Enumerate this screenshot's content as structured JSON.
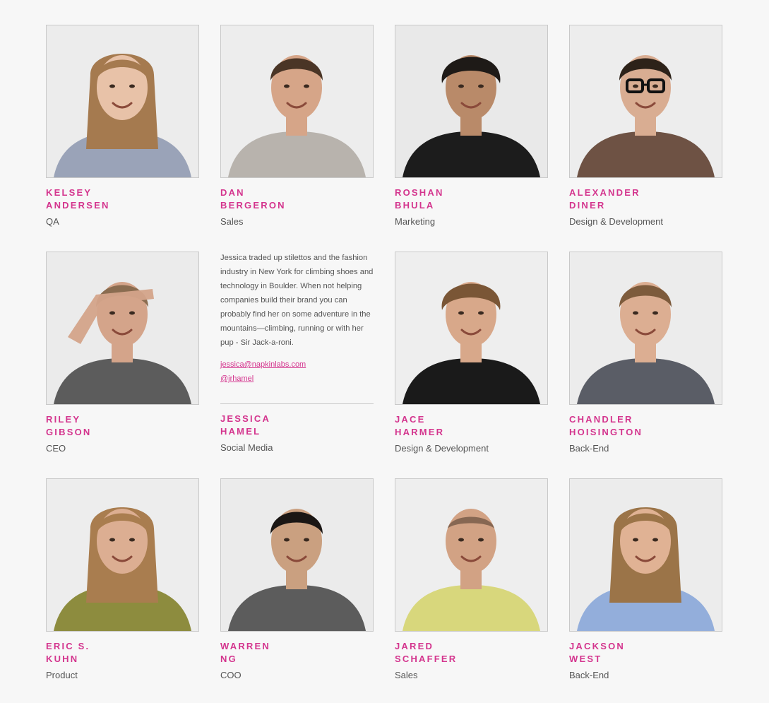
{
  "team": [
    {
      "first": "KELSEY",
      "last": "ANDERSEN",
      "role": "QA",
      "photo": {
        "bg": "#ececec",
        "skin": "#e8c2a8",
        "hair": "#a57a4f",
        "shirt": "#9aa3b8",
        "style": "long"
      }
    },
    {
      "first": "DAN",
      "last": "BERGERON",
      "role": "Sales",
      "photo": {
        "bg": "#ededed",
        "skin": "#d6a588",
        "hair": "#4a3526",
        "shirt": "#b8b3ad",
        "style": "short"
      }
    },
    {
      "first": "ROSHAN",
      "last": "BHULA",
      "role": "Marketing",
      "photo": {
        "bg": "#e9e9e9",
        "skin": "#b98a69",
        "hair": "#1e1a17",
        "shirt": "#1c1c1c",
        "style": "curly"
      }
    },
    {
      "first": "ALEXANDER",
      "last": "DINER",
      "role": "Design & Development",
      "photo": {
        "bg": "#ededed",
        "skin": "#d9ad92",
        "hair": "#2d2219",
        "shirt": "#6e5244",
        "style": "glasses"
      }
    },
    {
      "first": "RILEY",
      "last": "GIBSON",
      "role": "CEO",
      "photo": {
        "bg": "#ebebeb",
        "skin": "#d4a48a",
        "hair": "#8a6c50",
        "shirt": "#5c5c5c",
        "style": "salute"
      }
    },
    {
      "first": "JESSICA",
      "last": "HAMEL",
      "role": "Social Media",
      "bio": {
        "text": "Jessica traded up stilettos and the fashion industry in New York for climbing shoes and technology in Boulder. When not helping companies build their brand you can probably find her on some adventure in the mountains—climbing, running or with her pup - Sir Jack-a-roni.",
        "email": "jessica@napkinlabs.com",
        "twitter": "@jrhamel"
      }
    },
    {
      "first": "JACE",
      "last": "HARMER",
      "role": "Design & Development",
      "photo": {
        "bg": "#eeeeee",
        "skin": "#d8a88a",
        "hair": "#7a5636",
        "shirt": "#1a1a1a",
        "style": "curly"
      }
    },
    {
      "first": "CHANDLER",
      "last": "HOISINGTON",
      "role": "Back-End",
      "photo": {
        "bg": "#ececec",
        "skin": "#dcae92",
        "hair": "#7d5b3c",
        "shirt": "#5a5d66",
        "style": "short"
      }
    },
    {
      "first": "ERIC S.",
      "last": "KUHN",
      "role": "Product",
      "photo": {
        "bg": "#ededed",
        "skin": "#dcae92",
        "hair": "#a97d4f",
        "shirt": "#8d8c3e",
        "style": "long"
      }
    },
    {
      "first": "WARREN",
      "last": "NG",
      "role": "COO",
      "photo": {
        "bg": "#ebebeb",
        "skin": "#caa080",
        "hair": "#1a1614",
        "shirt": "#5c5c5c",
        "style": "short"
      }
    },
    {
      "first": "JARED",
      "last": "SCHAFFER",
      "role": "Sales",
      "photo": {
        "bg": "#eeeeee",
        "skin": "#d2a284",
        "hair": "#3b2b20",
        "shirt": "#d8d77c",
        "style": "bald"
      }
    },
    {
      "first": "JACKSON",
      "last": "WEST",
      "role": "Back-End",
      "photo": {
        "bg": "#ececec",
        "skin": "#e0b294",
        "hair": "#9b7448",
        "shirt": "#93aedb",
        "style": "long"
      }
    }
  ]
}
